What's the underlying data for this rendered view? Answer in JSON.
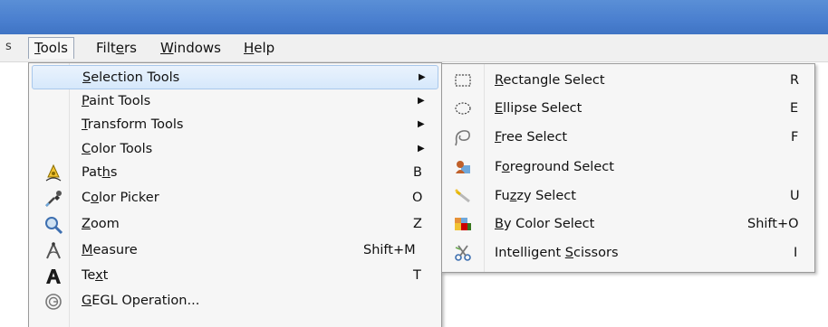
{
  "menubar": {
    "edge_glyph": "s",
    "items": [
      {
        "pre": "",
        "ul": "T",
        "post": "ools"
      },
      {
        "pre": "Filt",
        "ul": "e",
        "post": "rs"
      },
      {
        "pre": "",
        "ul": "W",
        "post": "indows"
      },
      {
        "pre": "",
        "ul": "H",
        "post": "elp"
      }
    ]
  },
  "tools_menu": {
    "items": [
      {
        "pre": "",
        "ul": "S",
        "post": "election Tools",
        "shortcut": "",
        "arrow": "▶",
        "icon": "none"
      },
      {
        "pre": "",
        "ul": "P",
        "post": "aint Tools",
        "shortcut": "",
        "arrow": "▶",
        "icon": "none"
      },
      {
        "pre": "",
        "ul": "T",
        "post": "ransform Tools",
        "shortcut": "",
        "arrow": "▶",
        "icon": "none"
      },
      {
        "pre": "",
        "ul": "C",
        "post": "olor Tools",
        "shortcut": "",
        "arrow": "▶",
        "icon": "none"
      },
      {
        "pre": "Pat",
        "ul": "h",
        "post": "s",
        "shortcut": "B",
        "arrow": "",
        "icon": "paths-icon"
      },
      {
        "pre": "C",
        "ul": "o",
        "post": "lor Picker",
        "shortcut": "O",
        "arrow": "",
        "icon": "color-picker-icon"
      },
      {
        "pre": "",
        "ul": "Z",
        "post": "oom",
        "shortcut": "Z",
        "arrow": "",
        "icon": "zoom-icon"
      },
      {
        "pre": "",
        "ul": "M",
        "post": "easure",
        "shortcut": "Shift+M",
        "arrow": "",
        "icon": "measure-icon"
      },
      {
        "pre": "Te",
        "ul": "x",
        "post": "t",
        "shortcut": "T",
        "arrow": "",
        "icon": "text-icon"
      },
      {
        "pre": "",
        "ul": "G",
        "post": "EGL Operation...",
        "shortcut": "",
        "arrow": "",
        "icon": "gegl-icon"
      }
    ]
  },
  "selection_menu": {
    "items": [
      {
        "pre": "",
        "ul": "R",
        "post": "ectangle Select",
        "shortcut": "R",
        "icon": "rectangle-select-icon"
      },
      {
        "pre": "",
        "ul": "E",
        "post": "llipse Select",
        "shortcut": "E",
        "icon": "ellipse-select-icon"
      },
      {
        "pre": "",
        "ul": "F",
        "post": "ree Select",
        "shortcut": "F",
        "icon": "free-select-icon"
      },
      {
        "pre": "F",
        "ul": "o",
        "post": "reground Select",
        "shortcut": "",
        "icon": "foreground-select-icon"
      },
      {
        "pre": "Fu",
        "ul": "z",
        "post": "zy Select",
        "shortcut": "U",
        "icon": "fuzzy-select-icon"
      },
      {
        "pre": "",
        "ul": "B",
        "post": "y Color Select",
        "shortcut": "Shift+O",
        "icon": "by-color-select-icon"
      },
      {
        "pre": "Intelligent ",
        "ul": "S",
        "post": "cissors",
        "shortcut": "I",
        "icon": "scissors-icon"
      }
    ]
  },
  "colors": {
    "titlebar": "#4a7fcf",
    "menu_bg": "#f6f6f6",
    "highlight": "#d6e8fb"
  }
}
